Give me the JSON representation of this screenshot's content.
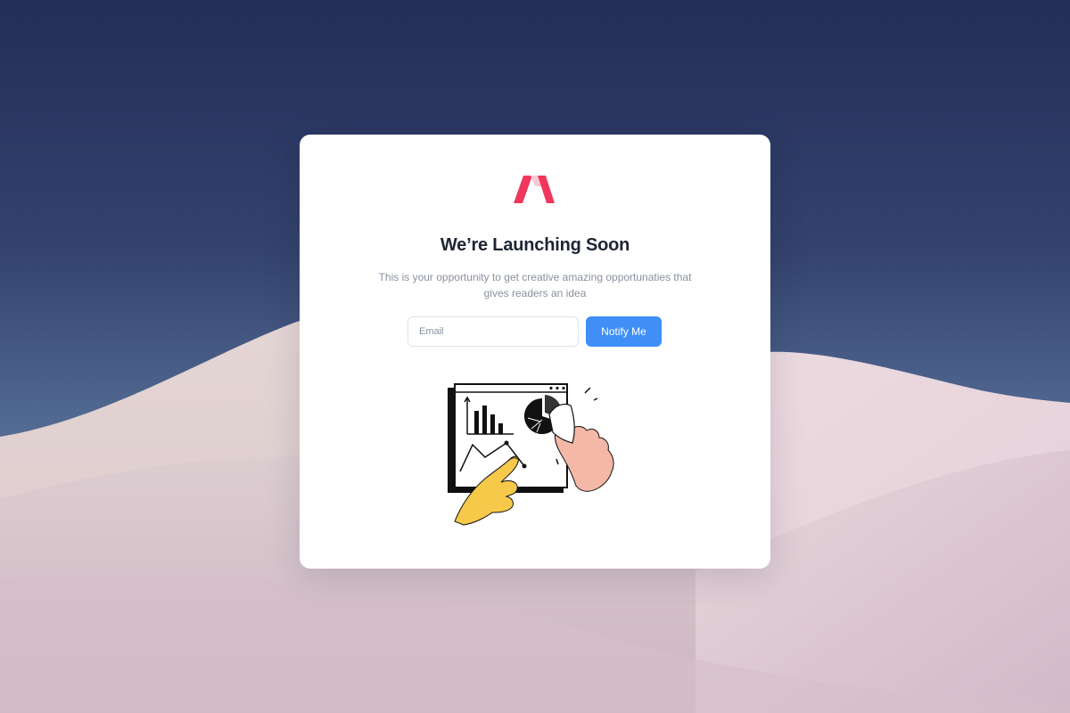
{
  "page": {
    "title": "We’re Launching Soon",
    "subtitle": "This is your opportunity to get creative amazing opportunaties that gives readers an idea"
  },
  "form": {
    "email_placeholder": "Email",
    "email_value": "",
    "submit_label": "Notify Me"
  },
  "brand": {
    "logo_icon": "brand-logo-icon",
    "accent": "#f0365d",
    "button_color": "#3f8ff7"
  },
  "illustration": {
    "icon": "analytics-dashboard-hands-illustration"
  }
}
